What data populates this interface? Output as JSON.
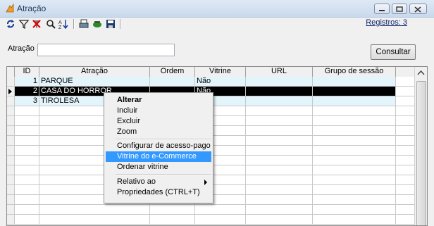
{
  "window": {
    "title": "Atração"
  },
  "toolbar": {
    "icons": [
      "refresh-icon",
      "filter-icon",
      "clear-filter-icon",
      "search-icon",
      "sort-icon",
      "print-icon",
      "export-icon",
      "save-icon"
    ],
    "registros": "Registros: 3"
  },
  "filter": {
    "label": "Atração",
    "value": "",
    "button": "Consultar"
  },
  "grid": {
    "columns": [
      "ID",
      "Atração",
      "Ordem",
      "Vitrine",
      "URL",
      "Grupo de sessão"
    ],
    "rows": [
      {
        "id": "1",
        "atracao": "PARQUE",
        "ordem": "",
        "vitrine": "Não",
        "url": "",
        "grupo": ""
      },
      {
        "id": "2",
        "atracao": "CASA DO HORROR",
        "ordem": "",
        "vitrine": "Não",
        "url": "",
        "grupo": ""
      },
      {
        "id": "3",
        "atracao": "TIROLESA",
        "ordem": "",
        "vitrine": "",
        "url": "",
        "grupo": ""
      }
    ]
  },
  "context_menu": {
    "items": [
      {
        "label": "Alterar"
      },
      {
        "label": "Incluir"
      },
      {
        "label": "Excluir"
      },
      {
        "label": "Zoom"
      },
      {
        "label": "Configurar de acesso-pago"
      },
      {
        "label": "Vitrine do e-Commerce"
      },
      {
        "label": "Ordenar vitrine"
      },
      {
        "label": "Relativo ao"
      },
      {
        "label": "Propriedades (CTRL+T)"
      }
    ]
  },
  "colors": {
    "selection": "#3399ff",
    "row_bg": "#e3f5fb",
    "accent": "#1e395b"
  }
}
